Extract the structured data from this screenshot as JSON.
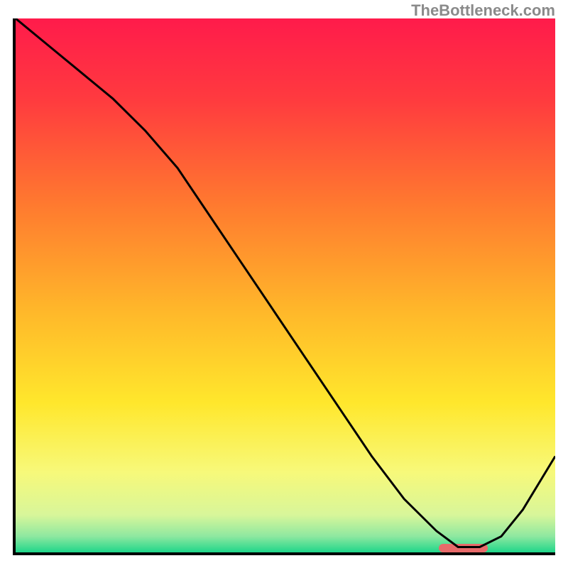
{
  "watermark": "TheBottleneck.com",
  "chart_data": {
    "type": "line",
    "title": "",
    "xlabel": "",
    "ylabel": "",
    "xlim": [
      0,
      100
    ],
    "ylim": [
      0,
      100
    ],
    "grid": false,
    "series": [
      {
        "name": "curve",
        "color": "#000000",
        "x": [
          0,
          6,
          12,
          18,
          24,
          30,
          36,
          42,
          48,
          54,
          60,
          66,
          72,
          78,
          82,
          86,
          90,
          94,
          100
        ],
        "y": [
          100,
          95,
          90,
          85,
          79,
          72,
          63,
          54,
          45,
          36,
          27,
          18,
          10,
          4,
          1,
          1,
          3,
          8,
          18
        ]
      }
    ],
    "gradient_stops": [
      {
        "pos": 0.0,
        "color": "#ff1b4b"
      },
      {
        "pos": 0.15,
        "color": "#ff3a3f"
      },
      {
        "pos": 0.35,
        "color": "#ff7a2f"
      },
      {
        "pos": 0.55,
        "color": "#ffb82a"
      },
      {
        "pos": 0.72,
        "color": "#ffe72c"
      },
      {
        "pos": 0.85,
        "color": "#f7f97a"
      },
      {
        "pos": 0.93,
        "color": "#d8f69a"
      },
      {
        "pos": 0.97,
        "color": "#8ee8a0"
      },
      {
        "pos": 1.0,
        "color": "#1fd68a"
      }
    ],
    "marker": {
      "color": "#e86a6a",
      "x_start": 78,
      "x_end": 87,
      "y": 1.3
    }
  }
}
